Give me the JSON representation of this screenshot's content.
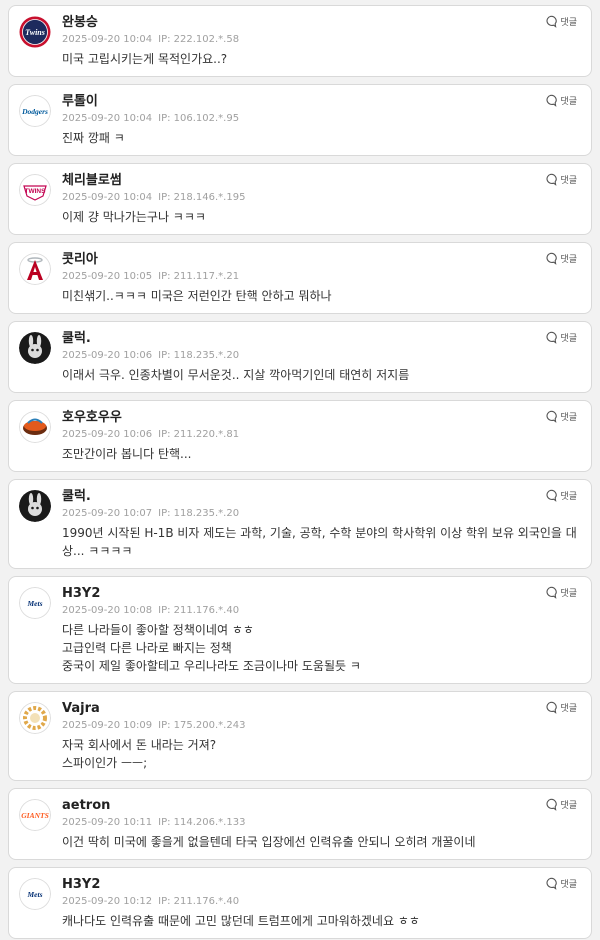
{
  "reply_label": "댓글",
  "comments": [
    {
      "user": "완봉승",
      "time": "2025-09-20 10:04",
      "ip": "IP: 222.102.*.58",
      "text": "미국 고립시키는게 목적인가요..?",
      "avatar": "twins-logo",
      "avatar_text": "Twins",
      "avatar_bg": "#1d2a5d",
      "avatar_fg": "#ffffff",
      "avatar_ring": "#c8102e"
    },
    {
      "user": "루톨이",
      "time": "2025-09-20 10:04",
      "ip": "IP: 106.102.*.95",
      "text": "진짜 깡패 ㅋ",
      "avatar": "dodgers-logo",
      "avatar_text": "Dodgers",
      "avatar_bg": "#ffffff",
      "avatar_fg": "#005a9c",
      "avatar_ring": "#dddddd"
    },
    {
      "user": "체리블로썸",
      "time": "2025-09-20 10:04",
      "ip": "IP: 218.146.*.195",
      "text": "이제 걍 막나가는구나 ㅋㅋㅋ",
      "avatar": "lg-twins-logo",
      "avatar_text": "TWINS",
      "avatar_bg": "#ffffff",
      "avatar_fg": "#c30452",
      "avatar_ring": "#c30452"
    },
    {
      "user": "콧리아",
      "time": "2025-09-20 10:05",
      "ip": "IP: 211.117.*.21",
      "text": "미친샊기..ㅋㅋㅋ 미국은 저런인간 탄핵 안하고 뭐하나",
      "avatar": "angels-logo",
      "avatar_text": "A",
      "avatar_bg": "#ffffff",
      "avatar_fg": "#ba0021",
      "avatar_ring": "#dddddd"
    },
    {
      "user": "쿨럭.",
      "time": "2025-09-20 10:06",
      "ip": "IP: 118.235.*.20",
      "text": "이래서 극우. 인종차별이 무서운것.. 지살 깍아먹기인데 태연히 저지름",
      "avatar": "bunny-avatar",
      "avatar_text": "",
      "avatar_bg": "#1a1a1a",
      "avatar_fg": "#dcdcdc",
      "avatar_ring": "#1a1a1a"
    },
    {
      "user": "호우호우우",
      "time": "2025-09-20 10:06",
      "ip": "IP: 211.220.*.81",
      "text": "조만간이라 봅니다 탄핵...",
      "avatar": "team-logo",
      "avatar_text": "",
      "avatar_bg": "#ffffff",
      "avatar_fg": "#e35a1c",
      "avatar_ring": "#dddddd"
    },
    {
      "user": "쿨럭.",
      "time": "2025-09-20 10:07",
      "ip": "IP: 118.235.*.20",
      "text": "1990년 시작된 H-1B 비자 제도는 과학, 기술, 공학, 수학 분야의 학사학위 이상 학위 보유 외국인을 대\n상... ㅋㅋㅋㅋ",
      "avatar": "bunny-avatar",
      "avatar_text": "",
      "avatar_bg": "#1a1a1a",
      "avatar_fg": "#dcdcdc",
      "avatar_ring": "#1a1a1a"
    },
    {
      "user": "H3Y2",
      "time": "2025-09-20 10:08",
      "ip": "IP: 211.176.*.40",
      "text": "다른 나라들이 좋아할 정책이네여 ㅎㅎ\n고급인력 다른 나라로 빠지는 정책\n중국이 제일 좋아할테고 우리나라도 조금이나마 도움될듯 ㅋ",
      "avatar": "mets-logo",
      "avatar_text": "Mets",
      "avatar_bg": "#ffffff",
      "avatar_fg": "#002d72",
      "avatar_ring": "#dddddd"
    },
    {
      "user": "Vajra",
      "time": "2025-09-20 10:09",
      "ip": "IP: 175.200.*.243",
      "text": "자국 회사에서 돈 내라는 거져?\n스파이인가 ㅡㅡ;",
      "avatar": "wreath-avatar",
      "avatar_text": "",
      "avatar_bg": "#ffffff",
      "avatar_fg": "#e0a84a",
      "avatar_ring": "#dddddd"
    },
    {
      "user": "aetron",
      "time": "2025-09-20 10:11",
      "ip": "IP: 114.206.*.133",
      "text": "이건 딱히 미국에 좋을게 없을텐데 타국 입장에선 인력유출 안되니 오히려 개꿀이네",
      "avatar": "giants-logo",
      "avatar_text": "GIANTS",
      "avatar_bg": "#ffffff",
      "avatar_fg": "#fd5a1e",
      "avatar_ring": "#dddddd"
    },
    {
      "user": "H3Y2",
      "time": "2025-09-20 10:12",
      "ip": "IP: 211.176.*.40",
      "text": "캐나다도 인력유출 때문에 고민 많던데 트럼프에게 고마워하겠네요 ㅎㅎ",
      "avatar": "mets-logo",
      "avatar_text": "Mets",
      "avatar_bg": "#ffffff",
      "avatar_fg": "#002d72",
      "avatar_ring": "#dddddd"
    }
  ]
}
